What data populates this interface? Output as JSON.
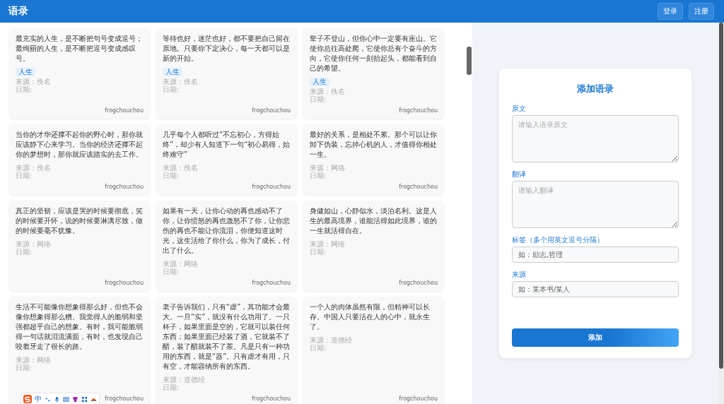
{
  "header": {
    "title": "语录",
    "buttons": [
      "登录",
      "注册"
    ]
  },
  "quotes": [
    {
      "text": "最充实的人生，是不断把句号变成逗号；最绚丽的人生，是不断把逗号变成感叹号。",
      "tags": [
        "人生"
      ],
      "source": "来源：佚名",
      "date": "日期:",
      "author": "frogchouchou"
    },
    {
      "text": "等待也好，迷茫也好，都不要把自己留在原地。只要你下定决心，每一天都可以是新的开始。",
      "tags": [
        "人生"
      ],
      "source": "来源：佚名",
      "date": "日期:",
      "author": "frogchouchou"
    },
    {
      "text": "辈子不登山，但你心中一定要有座山。它使你总往高处爬，它使你总有个奋斗的方向，它使你任何一刻抬起头，都能看到自己的希望。",
      "tags": [
        "人生"
      ],
      "source": "来源：佚名",
      "date": "日期:",
      "author": "frogchouchou"
    },
    {
      "text": "当你的才华还撑不起你的野心时，那你就应该静下心来学习。当你的经济还撑不起你的梦想时，那你就应该踏实的去工作。",
      "source": "来源：佚名",
      "date": "日期:",
      "author": "frogchouchou"
    },
    {
      "text": "几乎每个人都听过“不忘初心，方得始终”，却少有人知道下一句“初心易得，始终难守”",
      "source": "来源：佚名",
      "date": "日期:",
      "author": "frogchouchou"
    },
    {
      "text": "最好的关系，是相处不累。那个可以让你卸下伪装，忘掉心机的人，才值得你相处一生。",
      "source": "来源：网络",
      "date": "日期:",
      "author": "frogchouchou"
    },
    {
      "text": "真正的坚韧，应该是哭的时候要彻底，笑的时候要开怀，说的时候要淋漓尽致，做的时候要毫不犹豫。",
      "source": "来源：网络",
      "date": "日期:",
      "author": "frogchouchou"
    },
    {
      "text": "如果有一天，让你心动的再也感动不了你，让你愤怒的再也激怒不了你，让你悲伤的再也不能让你流泪，你便知道这时光，这生活给了你什么，你为了成长，付出了什么。",
      "source": "来源：网络",
      "date": "日期:",
      "author": "frogchouchou"
    },
    {
      "text": "身健如山，心静似水，淡泊名利。这是人生的最高境界，谁能活得如此境界，谁的一生就活得自在。",
      "source": "来源：网络",
      "date": "日期:",
      "author": "frogchouchou"
    },
    {
      "text": "生活不可能像你想象得那么好，但也不会像你想象得那么糟。我觉得人的脆弱和坚强都超乎自己的想象。有时，我可能脆弱得一句话就泪流满面，有时，也发现自己咬着牙走了很长的路。",
      "source": "来源：网络",
      "date": "日期:",
      "author": "frogchouchou"
    },
    {
      "text": "老子告诉我们，只有“虚”，其功能才会最大。一旦“实”，就没有什么功用了。一只杯子，如果里面是空的，它就可以装任何东西；如果里面已经装了酒，它就装不了醋，装了醋就装不了茶。凡是只有一种功用的东西，就是“器”。只有虚才有用，只有空，才能容纳所有的东西。",
      "source": "来源：道德经",
      "date": "日期:",
      "author": "frogchouchou"
    },
    {
      "text": "一个人的肉体虽然有限，但精神可以长存。中国人只要活在人的心中，就永生了。",
      "source": "来源：道德经",
      "date": "日期:",
      "author": "frogchouchou"
    }
  ],
  "form": {
    "title": "添加语录",
    "fields": [
      {
        "kind": "textarea",
        "label": "原文",
        "placeholder": "请输入语录原文"
      },
      {
        "kind": "textarea",
        "label": "翻译",
        "placeholder": "请输入翻译"
      },
      {
        "kind": "input",
        "label": "标签（多个用英文逗号分隔）",
        "placeholder": "如：励志,哲理"
      },
      {
        "kind": "input",
        "label": "来源",
        "placeholder": "如：某本书/某人"
      }
    ],
    "submit": "添加"
  },
  "ime_toolbar": {
    "label": "中"
  }
}
